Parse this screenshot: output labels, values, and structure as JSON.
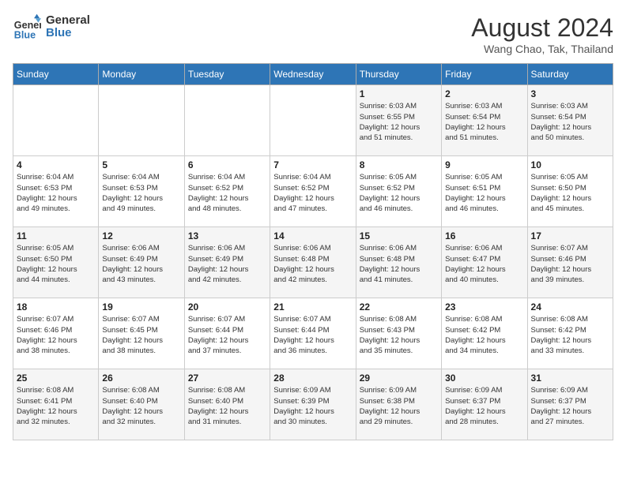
{
  "header": {
    "logo_line1": "General",
    "logo_line2": "Blue",
    "main_title": "August 2024",
    "subtitle": "Wang Chao, Tak, Thailand"
  },
  "days_of_week": [
    "Sunday",
    "Monday",
    "Tuesday",
    "Wednesday",
    "Thursday",
    "Friday",
    "Saturday"
  ],
  "weeks": [
    [
      {
        "day": "",
        "info": ""
      },
      {
        "day": "",
        "info": ""
      },
      {
        "day": "",
        "info": ""
      },
      {
        "day": "",
        "info": ""
      },
      {
        "day": "1",
        "info": "Sunrise: 6:03 AM\nSunset: 6:55 PM\nDaylight: 12 hours\nand 51 minutes."
      },
      {
        "day": "2",
        "info": "Sunrise: 6:03 AM\nSunset: 6:54 PM\nDaylight: 12 hours\nand 51 minutes."
      },
      {
        "day": "3",
        "info": "Sunrise: 6:03 AM\nSunset: 6:54 PM\nDaylight: 12 hours\nand 50 minutes."
      }
    ],
    [
      {
        "day": "4",
        "info": "Sunrise: 6:04 AM\nSunset: 6:53 PM\nDaylight: 12 hours\nand 49 minutes."
      },
      {
        "day": "5",
        "info": "Sunrise: 6:04 AM\nSunset: 6:53 PM\nDaylight: 12 hours\nand 49 minutes."
      },
      {
        "day": "6",
        "info": "Sunrise: 6:04 AM\nSunset: 6:52 PM\nDaylight: 12 hours\nand 48 minutes."
      },
      {
        "day": "7",
        "info": "Sunrise: 6:04 AM\nSunset: 6:52 PM\nDaylight: 12 hours\nand 47 minutes."
      },
      {
        "day": "8",
        "info": "Sunrise: 6:05 AM\nSunset: 6:52 PM\nDaylight: 12 hours\nand 46 minutes."
      },
      {
        "day": "9",
        "info": "Sunrise: 6:05 AM\nSunset: 6:51 PM\nDaylight: 12 hours\nand 46 minutes."
      },
      {
        "day": "10",
        "info": "Sunrise: 6:05 AM\nSunset: 6:50 PM\nDaylight: 12 hours\nand 45 minutes."
      }
    ],
    [
      {
        "day": "11",
        "info": "Sunrise: 6:05 AM\nSunset: 6:50 PM\nDaylight: 12 hours\nand 44 minutes."
      },
      {
        "day": "12",
        "info": "Sunrise: 6:06 AM\nSunset: 6:49 PM\nDaylight: 12 hours\nand 43 minutes."
      },
      {
        "day": "13",
        "info": "Sunrise: 6:06 AM\nSunset: 6:49 PM\nDaylight: 12 hours\nand 42 minutes."
      },
      {
        "day": "14",
        "info": "Sunrise: 6:06 AM\nSunset: 6:48 PM\nDaylight: 12 hours\nand 42 minutes."
      },
      {
        "day": "15",
        "info": "Sunrise: 6:06 AM\nSunset: 6:48 PM\nDaylight: 12 hours\nand 41 minutes."
      },
      {
        "day": "16",
        "info": "Sunrise: 6:06 AM\nSunset: 6:47 PM\nDaylight: 12 hours\nand 40 minutes."
      },
      {
        "day": "17",
        "info": "Sunrise: 6:07 AM\nSunset: 6:46 PM\nDaylight: 12 hours\nand 39 minutes."
      }
    ],
    [
      {
        "day": "18",
        "info": "Sunrise: 6:07 AM\nSunset: 6:46 PM\nDaylight: 12 hours\nand 38 minutes."
      },
      {
        "day": "19",
        "info": "Sunrise: 6:07 AM\nSunset: 6:45 PM\nDaylight: 12 hours\nand 38 minutes."
      },
      {
        "day": "20",
        "info": "Sunrise: 6:07 AM\nSunset: 6:44 PM\nDaylight: 12 hours\nand 37 minutes."
      },
      {
        "day": "21",
        "info": "Sunrise: 6:07 AM\nSunset: 6:44 PM\nDaylight: 12 hours\nand 36 minutes."
      },
      {
        "day": "22",
        "info": "Sunrise: 6:08 AM\nSunset: 6:43 PM\nDaylight: 12 hours\nand 35 minutes."
      },
      {
        "day": "23",
        "info": "Sunrise: 6:08 AM\nSunset: 6:42 PM\nDaylight: 12 hours\nand 34 minutes."
      },
      {
        "day": "24",
        "info": "Sunrise: 6:08 AM\nSunset: 6:42 PM\nDaylight: 12 hours\nand 33 minutes."
      }
    ],
    [
      {
        "day": "25",
        "info": "Sunrise: 6:08 AM\nSunset: 6:41 PM\nDaylight: 12 hours\nand 32 minutes."
      },
      {
        "day": "26",
        "info": "Sunrise: 6:08 AM\nSunset: 6:40 PM\nDaylight: 12 hours\nand 32 minutes."
      },
      {
        "day": "27",
        "info": "Sunrise: 6:08 AM\nSunset: 6:40 PM\nDaylight: 12 hours\nand 31 minutes."
      },
      {
        "day": "28",
        "info": "Sunrise: 6:09 AM\nSunset: 6:39 PM\nDaylight: 12 hours\nand 30 minutes."
      },
      {
        "day": "29",
        "info": "Sunrise: 6:09 AM\nSunset: 6:38 PM\nDaylight: 12 hours\nand 29 minutes."
      },
      {
        "day": "30",
        "info": "Sunrise: 6:09 AM\nSunset: 6:37 PM\nDaylight: 12 hours\nand 28 minutes."
      },
      {
        "day": "31",
        "info": "Sunrise: 6:09 AM\nSunset: 6:37 PM\nDaylight: 12 hours\nand 27 minutes."
      }
    ]
  ]
}
